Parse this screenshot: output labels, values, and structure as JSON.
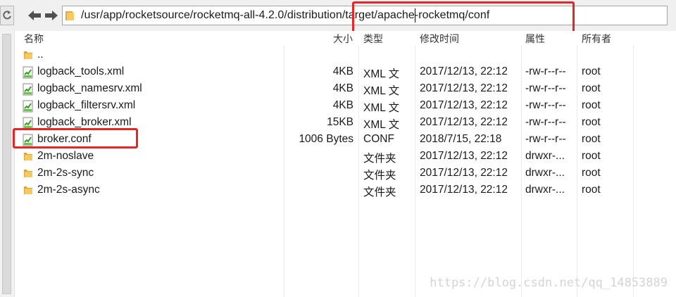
{
  "toolbar": {
    "address_path": "/usr/app/rocketsource/rocketmq-all-4.2.0/distribution/target/apache-rocketmq/conf",
    "refresh_icon": "refresh-icon",
    "back_icon": "arrow-left-icon",
    "forward_icon": "arrow-right-icon"
  },
  "columns": {
    "name": "名称",
    "size": "大小",
    "type": "类型",
    "modified": "修改时间",
    "permissions": "属性",
    "owner": "所有者"
  },
  "files": [
    {
      "name": "..",
      "size": "",
      "type": "",
      "modified": "",
      "permissions": "",
      "owner": "",
      "icon": "folder-icon"
    },
    {
      "name": "logback_tools.xml",
      "size": "4KB",
      "type": "XML 文",
      "modified": "2017/12/13, 22:12",
      "permissions": "-rw-r--r--",
      "owner": "root",
      "icon": "file-icon"
    },
    {
      "name": "logback_namesrv.xml",
      "size": "4KB",
      "type": "XML 文",
      "modified": "2017/12/13, 22:12",
      "permissions": "-rw-r--r--",
      "owner": "root",
      "icon": "file-icon"
    },
    {
      "name": "logback_filtersrv.xml",
      "size": "4KB",
      "type": "XML 文",
      "modified": "2017/12/13, 22:12",
      "permissions": "-rw-r--r--",
      "owner": "root",
      "icon": "file-icon"
    },
    {
      "name": "logback_broker.xml",
      "size": "15KB",
      "type": "XML 文",
      "modified": "2017/12/13, 22:12",
      "permissions": "-rw-r--r--",
      "owner": "root",
      "icon": "file-icon"
    },
    {
      "name": "broker.conf",
      "size": "1006 Bytes",
      "type": "CONF",
      "modified": "2018/7/15, 22:18",
      "permissions": "-rw-r--r--",
      "owner": "root",
      "icon": "file-icon"
    },
    {
      "name": "2m-noslave",
      "size": "",
      "type": "文件夹",
      "modified": "2017/12/13, 22:12",
      "permissions": "drwxr-...",
      "owner": "root",
      "icon": "folder-icon"
    },
    {
      "name": "2m-2s-sync",
      "size": "",
      "type": "文件夹",
      "modified": "2017/12/13, 22:12",
      "permissions": "drwxr-...",
      "owner": "root",
      "icon": "folder-icon"
    },
    {
      "name": "2m-2s-async",
      "size": "",
      "type": "文件夹",
      "modified": "2017/12/13, 22:12",
      "permissions": "drwxr-...",
      "owner": "root",
      "icon": "folder-icon"
    }
  ],
  "watermark": "https://blog.csdn.net/qq_14853889",
  "colors": {
    "highlight": "#e52626",
    "folder": "#f2c25a",
    "file_icon": "#4caf2f"
  }
}
